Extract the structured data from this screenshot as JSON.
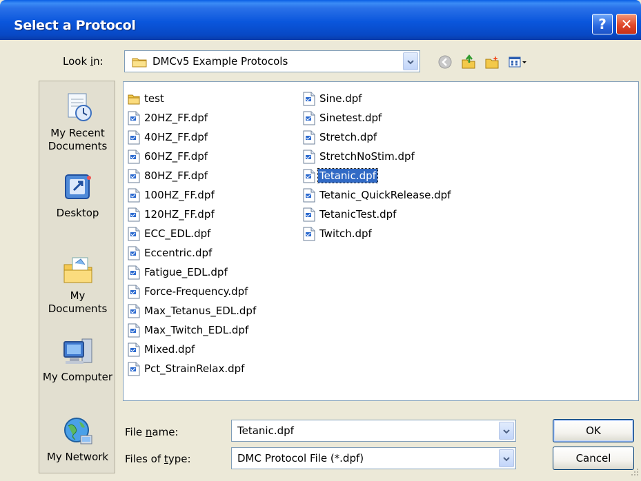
{
  "window": {
    "title": "Select a Protocol",
    "help_glyph": "?",
    "close_glyph": "✕"
  },
  "look_in": {
    "label_pre": "Look ",
    "label_accel": "i",
    "label_post": "n:",
    "value": "DMCv5 Example Protocols"
  },
  "toolbar": {
    "icons": [
      "back-icon",
      "up-folder-icon",
      "new-folder-icon",
      "view-menu-icon"
    ]
  },
  "places": [
    {
      "label": "My Recent Documents",
      "icon": "recent-documents-icon"
    },
    {
      "label": "Desktop",
      "icon": "desktop-icon"
    },
    {
      "label": "My Documents",
      "icon": "my-documents-icon"
    },
    {
      "label": "My Computer",
      "icon": "my-computer-icon"
    },
    {
      "label": "My Network",
      "icon": "my-network-icon"
    }
  ],
  "files": {
    "column1": [
      {
        "name": "test",
        "type": "folder"
      },
      {
        "name": "20HZ_FF.dpf",
        "type": "file"
      },
      {
        "name": "40HZ_FF.dpf",
        "type": "file"
      },
      {
        "name": "60HZ_FF.dpf",
        "type": "file"
      },
      {
        "name": "80HZ_FF.dpf",
        "type": "file"
      },
      {
        "name": "100HZ_FF.dpf",
        "type": "file"
      },
      {
        "name": "120HZ_FF.dpf",
        "type": "file"
      },
      {
        "name": "ECC_EDL.dpf",
        "type": "file"
      },
      {
        "name": "Eccentric.dpf",
        "type": "file"
      },
      {
        "name": "Fatigue_EDL.dpf",
        "type": "file"
      },
      {
        "name": "Force-Frequency.dpf",
        "type": "file"
      },
      {
        "name": "Max_Tetanus_EDL.dpf",
        "type": "file"
      },
      {
        "name": "Max_Twitch_EDL.dpf",
        "type": "file"
      },
      {
        "name": "Mixed.dpf",
        "type": "file"
      },
      {
        "name": "Pct_StrainRelax.dpf",
        "type": "file"
      }
    ],
    "column2": [
      {
        "name": "Sine.dpf",
        "type": "file"
      },
      {
        "name": "Sinetest.dpf",
        "type": "file"
      },
      {
        "name": "Stretch.dpf",
        "type": "file"
      },
      {
        "name": "StretchNoStim.dpf",
        "type": "file"
      },
      {
        "name": "Tetanic.dpf",
        "type": "file",
        "selected": true
      },
      {
        "name": "Tetanic_QuickRelease.dpf",
        "type": "file"
      },
      {
        "name": "TetanicTest.dpf",
        "type": "file"
      },
      {
        "name": "Twitch.dpf",
        "type": "file"
      }
    ]
  },
  "file_name": {
    "label_pre": "File ",
    "label_accel": "n",
    "label_post": "ame:",
    "value": "Tetanic.dpf"
  },
  "file_type": {
    "label_pre": "Files of ",
    "label_accel": "t",
    "label_post": "ype:",
    "value": "DMC Protocol File (*.dpf)"
  },
  "buttons": {
    "ok": "OK",
    "cancel": "Cancel"
  },
  "colors": {
    "titlebar": "#0a56dc",
    "selection": "#316ac5",
    "dialog_bg": "#ece9d8"
  }
}
